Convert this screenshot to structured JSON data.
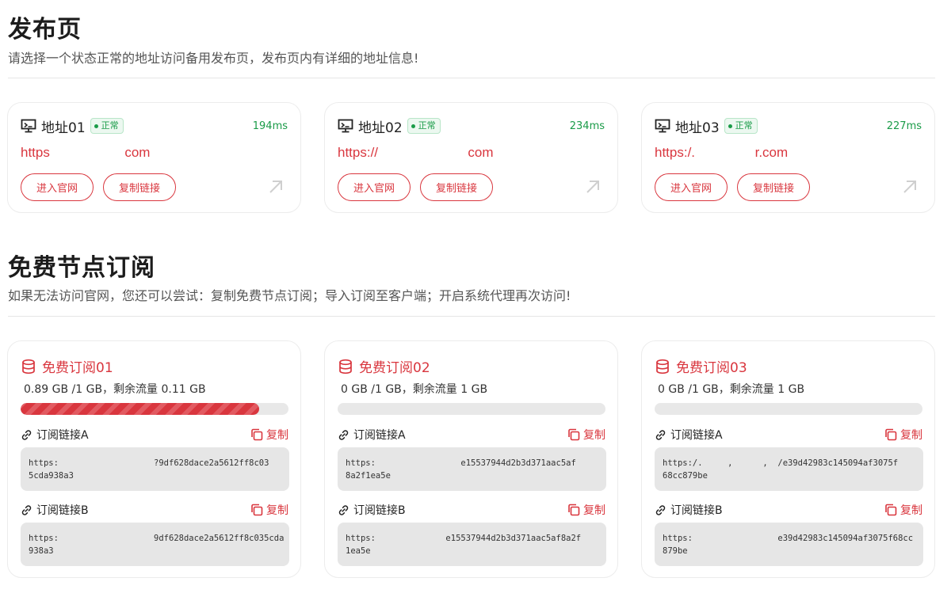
{
  "publish": {
    "title": "发布页",
    "desc": "请选择一个状态正常的地址访问备用发布页，发布页内有详细的地址信息!",
    "cards": [
      {
        "name": "地址01",
        "status": "正常",
        "latency": "194ms",
        "url": "https                    com",
        "enter_label": "进入官网",
        "copy_label": "复制链接"
      },
      {
        "name": "地址02",
        "status": "正常",
        "latency": "234ms",
        "url": "https://                        com",
        "enter_label": "进入官网",
        "copy_label": "复制链接"
      },
      {
        "name": "地址03",
        "status": "正常",
        "latency": "227ms",
        "url": "https:/.                r.com",
        "enter_label": "进入官网",
        "copy_label": "复制链接"
      }
    ]
  },
  "subscribe": {
    "title": "免费节点订阅",
    "desc": "如果无法访问官网，您还可以尝试：复制免费节点订阅；导入订阅至客户端；开启系统代理再次访问!",
    "cards": [
      {
        "name": "免费订阅01",
        "usage": "0.89 GB /1 GB，剩余流量 0.11 GB",
        "progress": 0.89,
        "link_a_label": "订阅链接A",
        "link_a": "https:                   ?9df628dace2a5612ff8c03\n5cda938a3",
        "link_b_label": "订阅链接B",
        "link_b": "https:                   9df628dace2a5612ff8c035cda\n938a3",
        "copy_label": "复制"
      },
      {
        "name": "免费订阅02",
        "usage": "0 GB /1 GB，剩余流量 1 GB",
        "progress": 0,
        "link_a_label": "订阅链接A",
        "link_a": "https:                 e15537944d2b3d371aac5af\n8a2f1ea5e",
        "link_b_label": "订阅链接B",
        "link_b": "https:              e15537944d2b3d371aac5af8a2f\n1ea5e",
        "copy_label": "复制"
      },
      {
        "name": "免费订阅03",
        "usage": "0 GB /1 GB，剩余流量 1 GB",
        "progress": 0,
        "link_a_label": "订阅链接A",
        "link_a": "https:/.     ,      ,  /e39d42983c145094af3075f\n68cc879be",
        "link_b_label": "订阅链接B",
        "link_b": "https:                 e39d42983c145094af3075f68cc\n879be",
        "copy_label": "复制"
      }
    ]
  }
}
